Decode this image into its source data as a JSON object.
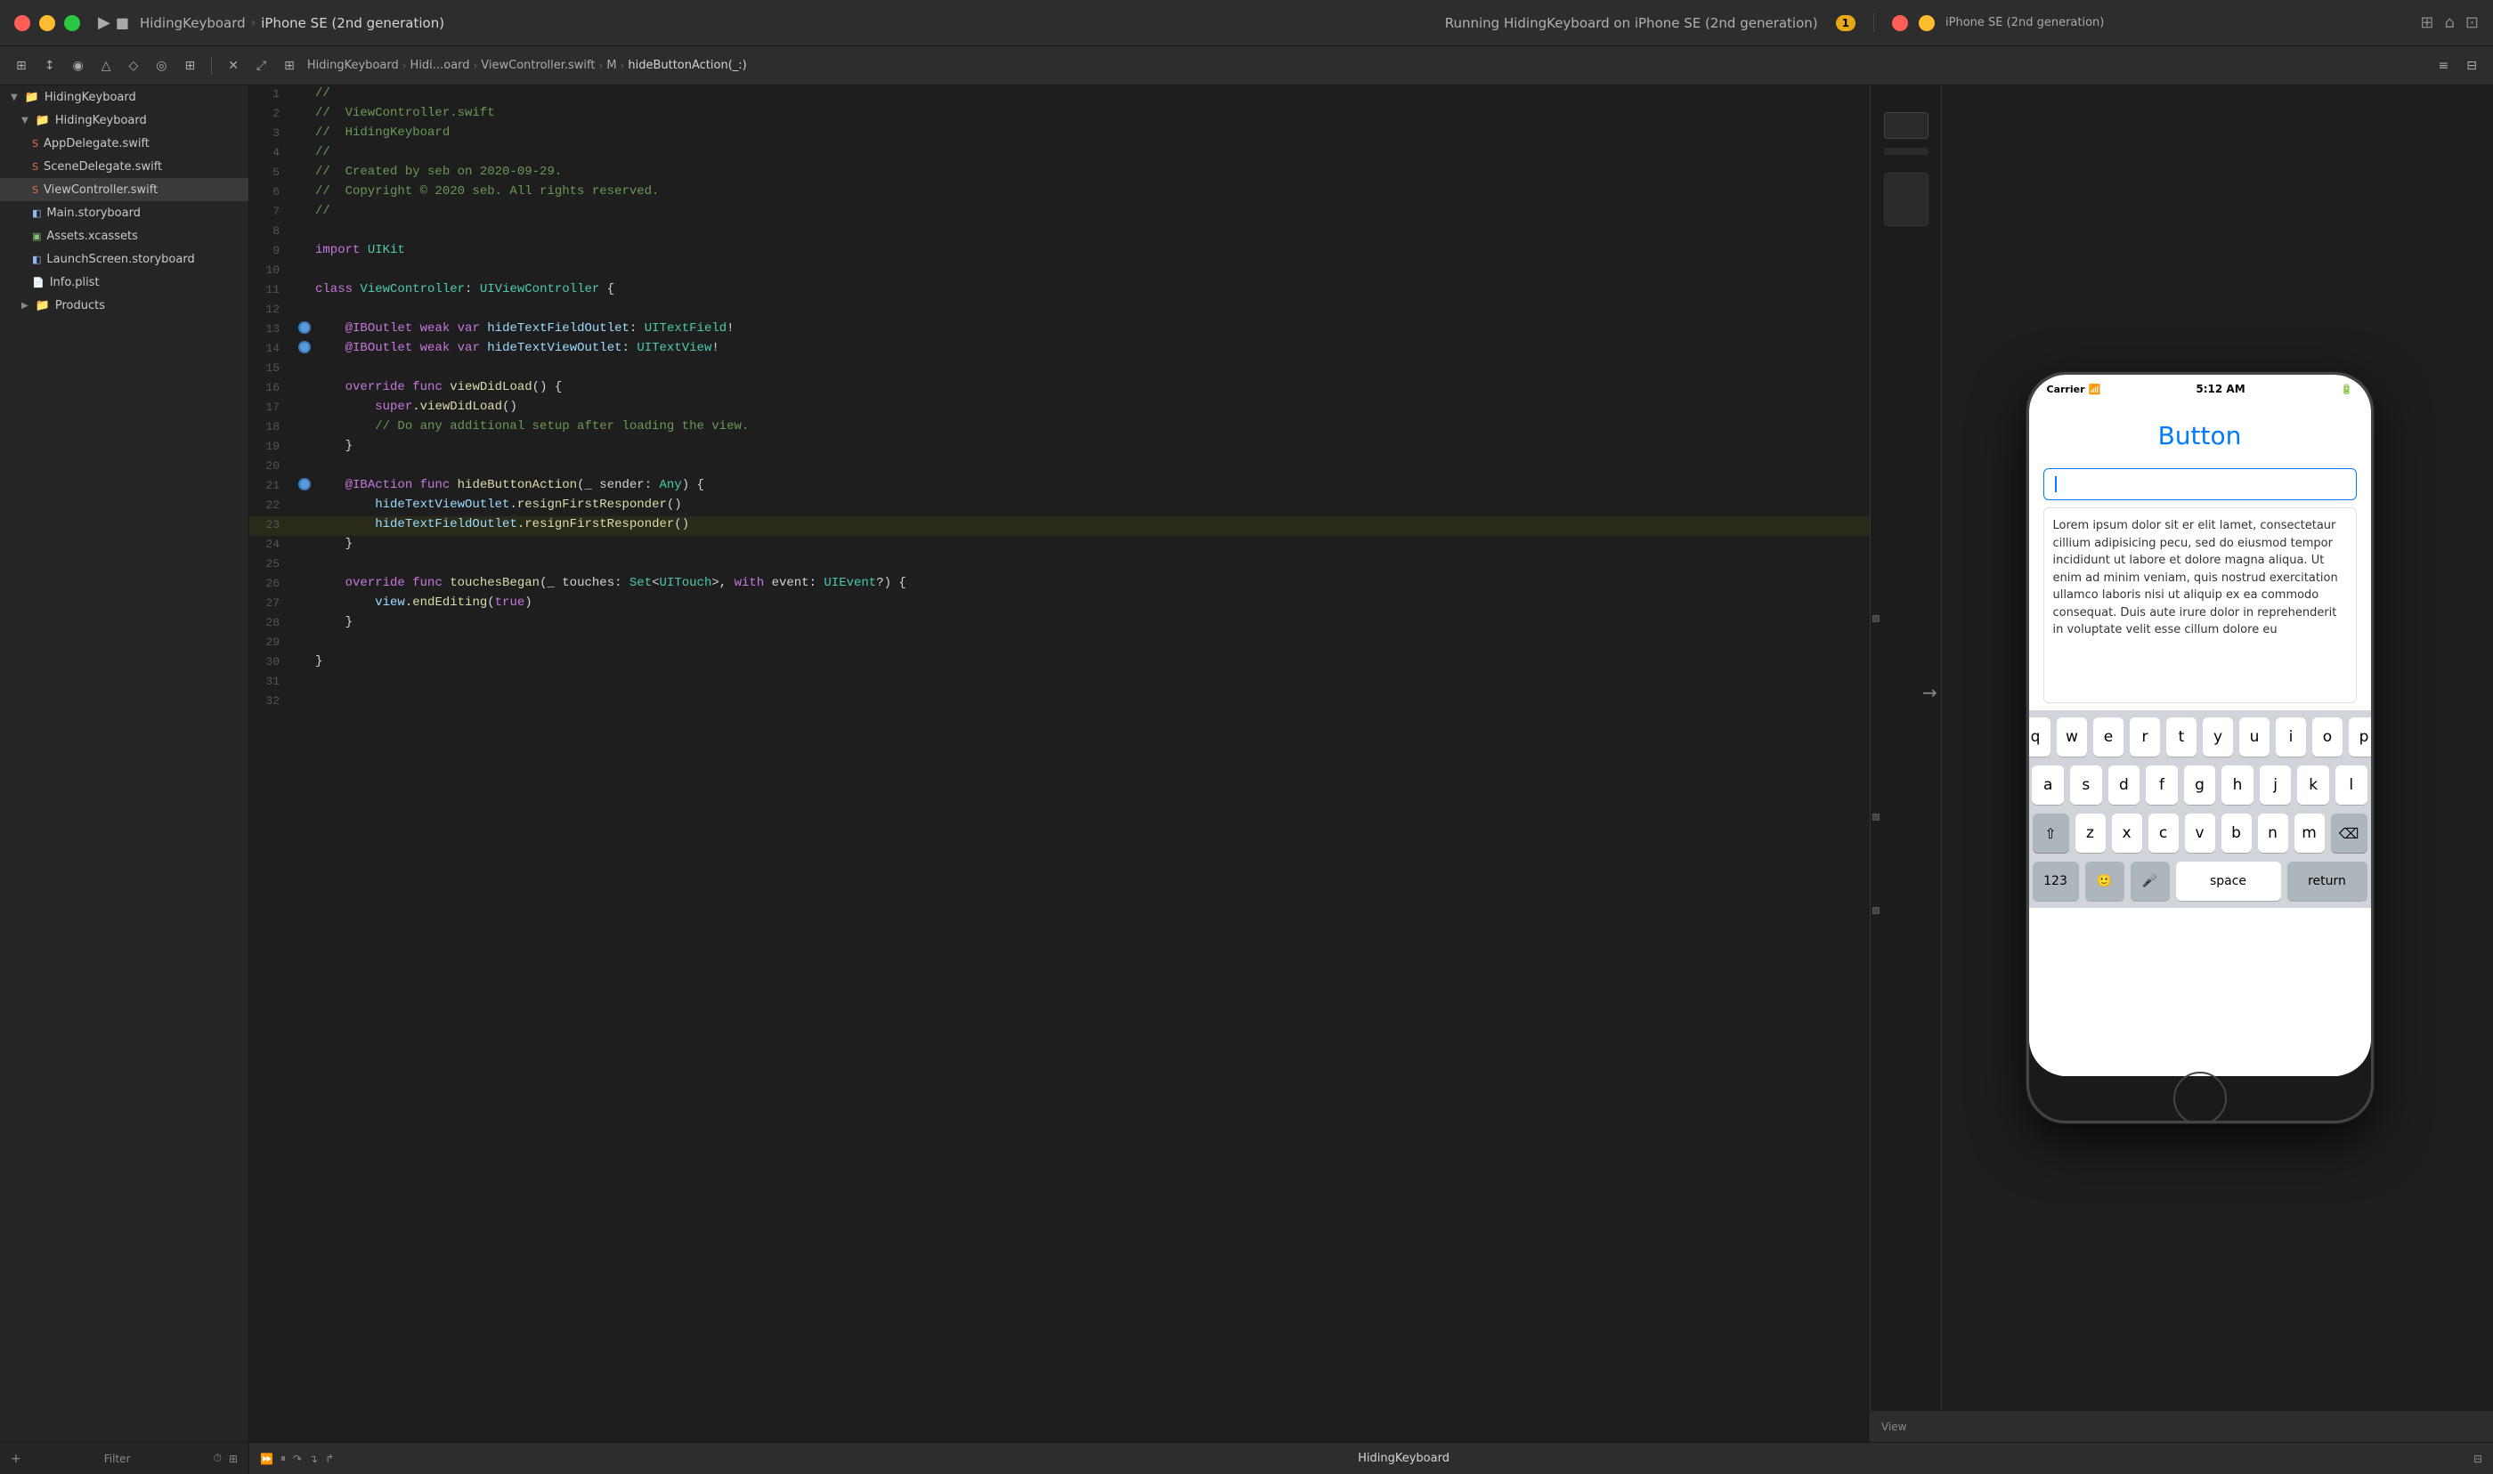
{
  "titlebar": {
    "app_name": "HidingKeyboard",
    "separator": "›",
    "device": "iPhone SE (2nd generation)",
    "running_label": "Running HidingKeyboard on iPhone SE (2nd generation)",
    "warning_count": "1",
    "right_device": "iPhone SE (2nd gener...",
    "tl_red": "#ff5f57",
    "tl_yellow": "#febc2e",
    "tl_green": "#28c840"
  },
  "toolbar": {
    "breadcrumbs": [
      "HidingKeyboard",
      "Hidi...oard",
      "ViewController.swift",
      "M",
      "hideButtonAction(_:)"
    ]
  },
  "navigator": {
    "project_name": "HidingKeyboard",
    "group_name": "HidingKeyboard",
    "files": [
      {
        "name": "AppDelegate.swift",
        "type": "swift",
        "indent": 3
      },
      {
        "name": "SceneDelegate.swift",
        "type": "swift",
        "indent": 3
      },
      {
        "name": "ViewController.swift",
        "type": "swift",
        "indent": 3,
        "selected": true
      },
      {
        "name": "Main.storyboard",
        "type": "storyboard",
        "indent": 3
      },
      {
        "name": "Assets.xcassets",
        "type": "xcassets",
        "indent": 3
      },
      {
        "name": "LaunchScreen.storyboard",
        "type": "storyboard",
        "indent": 3
      },
      {
        "name": "Info.plist",
        "type": "plist",
        "indent": 3
      }
    ],
    "products": "Products"
  },
  "code": {
    "filename": "ViewController.swift",
    "project": "HidingKeyboard",
    "author": "seb",
    "date": "2020-09-29",
    "copyright": "Copyright © 2020 seb. All rights reserved.",
    "lines": [
      {
        "num": 1,
        "text": "//",
        "gutter": ""
      },
      {
        "num": 2,
        "text": "//  ViewController.swift",
        "gutter": ""
      },
      {
        "num": 3,
        "text": "//  HidingKeyboard",
        "gutter": ""
      },
      {
        "num": 4,
        "text": "//",
        "gutter": ""
      },
      {
        "num": 5,
        "text": "//  Created by seb on 2020-09-29.",
        "gutter": ""
      },
      {
        "num": 6,
        "text": "//  Copyright © 2020 seb. All rights reserved.",
        "gutter": ""
      },
      {
        "num": 7,
        "text": "//",
        "gutter": ""
      },
      {
        "num": 8,
        "text": "",
        "gutter": ""
      },
      {
        "num": 9,
        "text": "import UIKit",
        "gutter": ""
      },
      {
        "num": 10,
        "text": "",
        "gutter": ""
      },
      {
        "num": 11,
        "text": "class ViewController: UIViewController {",
        "gutter": ""
      },
      {
        "num": 12,
        "text": "",
        "gutter": ""
      },
      {
        "num": 13,
        "text": "    @IBOutlet weak var hideTextFieldOutlet: UITextField!",
        "gutter": "dot"
      },
      {
        "num": 14,
        "text": "    @IBOutlet weak var hideTextViewOutlet: UITextView!",
        "gutter": "dot"
      },
      {
        "num": 15,
        "text": "",
        "gutter": ""
      },
      {
        "num": 16,
        "text": "    override func viewDidLoad() {",
        "gutter": ""
      },
      {
        "num": 17,
        "text": "        super.viewDidLoad()",
        "gutter": ""
      },
      {
        "num": 18,
        "text": "        // Do any additional setup after loading the view.",
        "gutter": ""
      },
      {
        "num": 19,
        "text": "    }",
        "gutter": ""
      },
      {
        "num": 20,
        "text": "",
        "gutter": ""
      },
      {
        "num": 21,
        "text": "    @IBAction func hideButtonAction(_ sender: Any) {",
        "gutter": "dot"
      },
      {
        "num": 22,
        "text": "        hideTextViewOutlet.resignFirstResponder()",
        "gutter": ""
      },
      {
        "num": 23,
        "text": "        hideTextFieldOutlet.resignFirstResponder()",
        "gutter": "",
        "highlighted": true
      },
      {
        "num": 24,
        "text": "    }",
        "gutter": ""
      },
      {
        "num": 25,
        "text": "",
        "gutter": ""
      },
      {
        "num": 26,
        "text": "    override func touchesBegan(_ touches: Set<UITouch>, with event: UIEvent?) {",
        "gutter": ""
      },
      {
        "num": 27,
        "text": "        view.endEditing(true)",
        "gutter": ""
      },
      {
        "num": 28,
        "text": "    }",
        "gutter": ""
      },
      {
        "num": 29,
        "text": "",
        "gutter": ""
      },
      {
        "num": 30,
        "text": "}",
        "gutter": ""
      },
      {
        "num": 31,
        "text": "",
        "gutter": ""
      },
      {
        "num": 32,
        "text": "",
        "gutter": ""
      }
    ]
  },
  "simulator": {
    "title": "iPhone SE (2nd generation)",
    "status_carrier": "Carrier",
    "status_time": "5:12 AM",
    "button_label": "Button",
    "text_field_placeholder": "",
    "lorem_text": "Lorem ipsum dolor sit er elit lamet, consectetaur cillium adipisicing pecu, sed do eiusmod tempor incididunt ut labore et dolore magna aliqua. Ut enim ad minim veniam, quis nostrud exercitation ullamco laboris nisi ut aliquip ex ea commodo consequat. Duis aute irure dolor in reprehenderit in voluptate velit esse cillum dolore eu",
    "keyboard": {
      "row1": [
        "q",
        "w",
        "e",
        "r",
        "t",
        "y",
        "u",
        "i",
        "o",
        "p"
      ],
      "row2": [
        "a",
        "s",
        "d",
        "f",
        "g",
        "h",
        "j",
        "k",
        "l"
      ],
      "row3": [
        "z",
        "x",
        "c",
        "v",
        "b",
        "n",
        "m"
      ],
      "bottom": [
        "123",
        "🙂",
        "🎤",
        "space",
        "return"
      ]
    }
  },
  "status_bar": {
    "filter_label": "Filter",
    "app_label": "HidingKeyboard",
    "view_label": "View"
  }
}
